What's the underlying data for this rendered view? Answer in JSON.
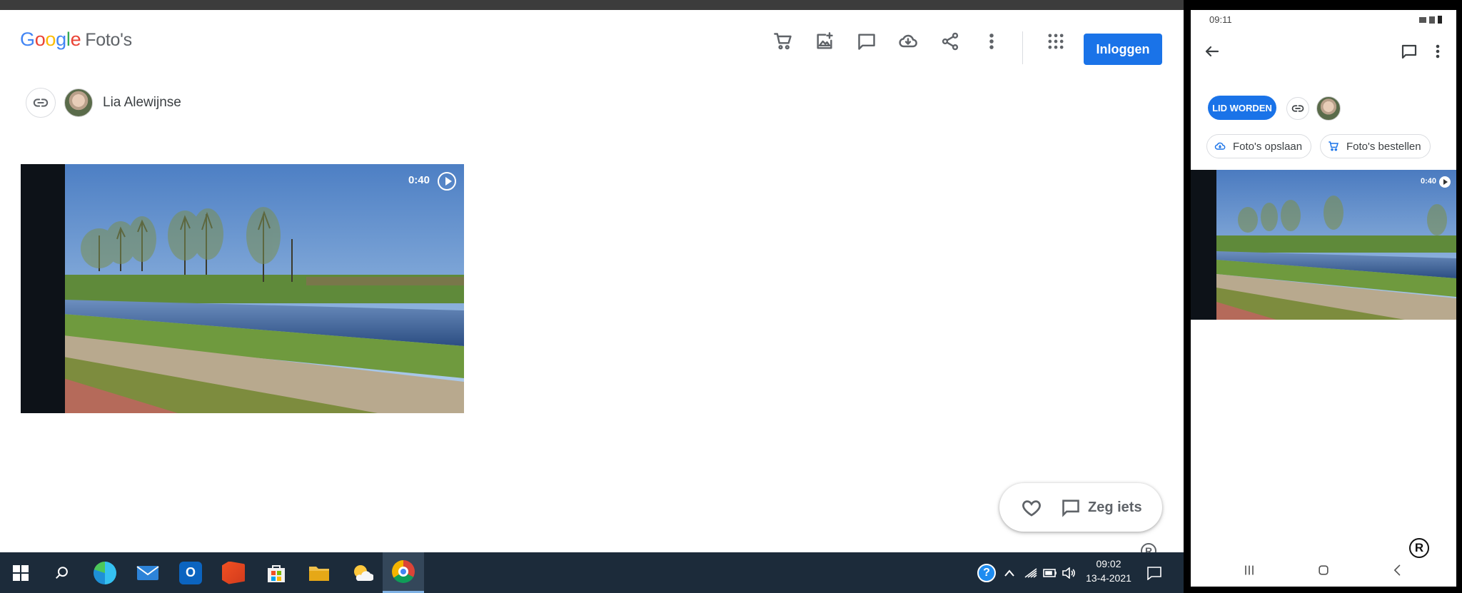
{
  "browser": {
    "logo": {
      "g1": "G",
      "g2": "o",
      "g3": "o",
      "g4": "g",
      "g5": "l",
      "g6": "e",
      "product": "Foto's"
    },
    "header_icons": [
      "cart-icon",
      "add-photo-icon",
      "comment-icon",
      "cloud-download-icon",
      "share-icon",
      "more-vert-icon",
      "apps-grid-icon"
    ],
    "login_label": "Inloggen",
    "owner_name": "Lia Alewijnse",
    "video": {
      "duration": "0:40"
    },
    "comment": {
      "placeholder": "Zeg iets"
    },
    "reg_mark": "R"
  },
  "taskbar": {
    "apps": [
      "start-icon",
      "search-icon",
      "edge-icon",
      "mail-icon",
      "outlook-icon",
      "office-icon",
      "store-icon",
      "file-explorer-icon",
      "weather-icon",
      "chrome-icon"
    ],
    "clock": {
      "time": "09:02",
      "date": "13-4-2021"
    }
  },
  "phone": {
    "status_time": "09:11",
    "join_label": "LID WORDEN",
    "chip_save": "Foto's opslaan",
    "chip_order": "Foto's bestellen",
    "video": {
      "duration": "0:40"
    },
    "reg_mark": "R"
  },
  "colors": {
    "accent": "#1a73e8",
    "taskbar": "#1c2b3a",
    "icon_gray": "#5f6368"
  }
}
